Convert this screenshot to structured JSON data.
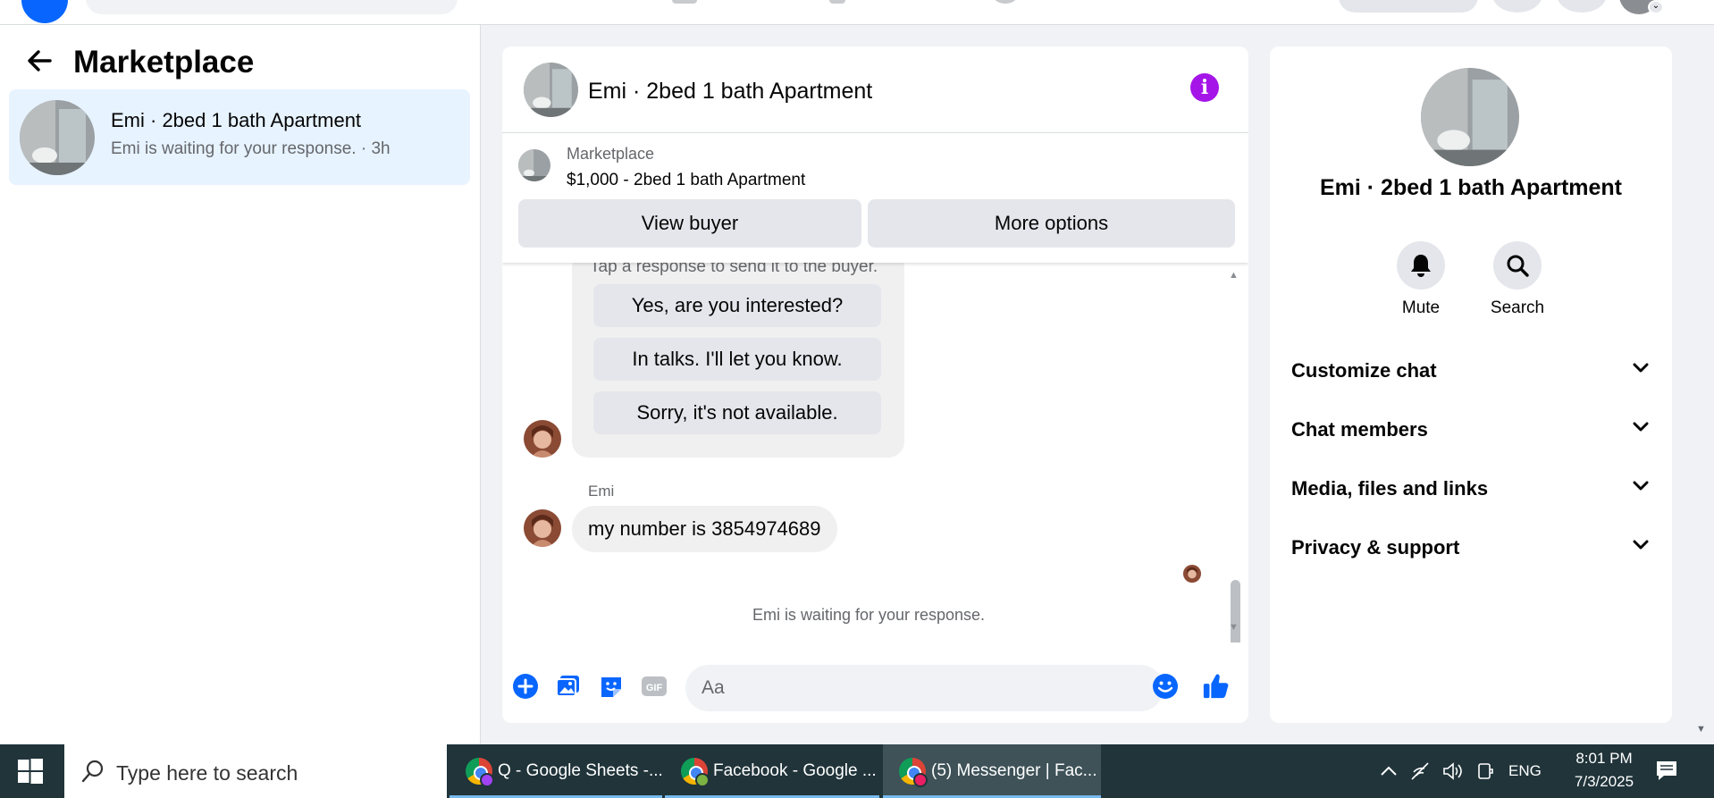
{
  "left_panel": {
    "title": "Marketplace",
    "thread": {
      "name": "Emi · 2bed 1 bath Apartment",
      "subtitle": "Emi is waiting for your response. · 3h"
    }
  },
  "chat": {
    "header_title": "Emi · 2bed 1 bath Apartment",
    "listing": {
      "label": "Marketplace",
      "price_title": "$1,000 - 2bed 1 bath Apartment",
      "view_buyer": "View buyer",
      "more_options": "More options"
    },
    "quick_reply_hint": "Tap a response to send it to the buyer.",
    "quick_replies": [
      "Yes, are you interested?",
      "In talks. I'll let you know.",
      "Sorry, it's not available."
    ],
    "sender_name": "Emi",
    "message": "my number is 3854974689",
    "waiting_note": "Emi is waiting for your response.",
    "input_placeholder": "Aa"
  },
  "right_panel": {
    "title": "Emi · 2bed 1 bath Apartment",
    "actions": [
      "Mute",
      "Search"
    ],
    "sections": [
      "Customize chat",
      "Chat members",
      "Media, files and links",
      "Privacy & support"
    ]
  },
  "taskbar": {
    "search_placeholder": "Type here to search",
    "apps": [
      "Q - Google Sheets -...",
      "Facebook - Google ...",
      "(5) Messenger | Fac..."
    ],
    "language": "ENG",
    "time": "8:01 PM",
    "date": "7/3/2025"
  },
  "colors": {
    "accent": "#0866ff",
    "info": "#a515e8",
    "taskbar": "#20343a",
    "selected_thread": "#e7f3ff"
  }
}
